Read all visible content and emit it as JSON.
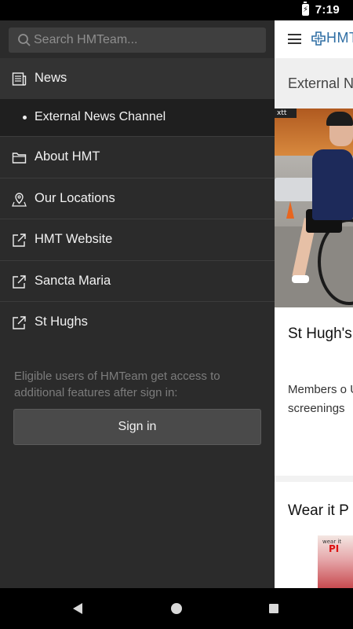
{
  "status_bar": {
    "time": "7:19",
    "battery_icon": "battery-charging-icon"
  },
  "app": {
    "logo_text": "HMT",
    "page_header": "External N",
    "news_cards": [
      {
        "title": "St Hugh's New Sea",
        "excerpt": "Members o UCI (Intern the new se screenings",
        "photo_sign": "xtt"
      },
      {
        "title": "Wear it P",
        "thumb_text_1": "wear it",
        "thumb_text_2": "PI"
      }
    ]
  },
  "drawer": {
    "search": {
      "placeholder": "Search HMTeam..."
    },
    "menu": [
      {
        "label": "News",
        "icon": "news-icon"
      },
      {
        "label": "External News Channel",
        "icon": "bullet"
      },
      {
        "label": "About HMT",
        "icon": "folder-icon"
      },
      {
        "label": "Our Locations",
        "icon": "location-pin-icon"
      },
      {
        "label": "HMT Website",
        "icon": "external-link-icon"
      },
      {
        "label": "Sancta Maria",
        "icon": "external-link-icon"
      },
      {
        "label": "St Hughs",
        "icon": "external-link-icon"
      }
    ],
    "signin_note": "Eligible users of HMTeam get access to additional features after sign in:",
    "signin_button": "Sign in"
  },
  "colors": {
    "drawer_bg": "#2b2b2b",
    "selected_item_bg": "#333333",
    "sub_item_bg": "#1f1f1f",
    "brand_blue": "#2f6ea4"
  }
}
